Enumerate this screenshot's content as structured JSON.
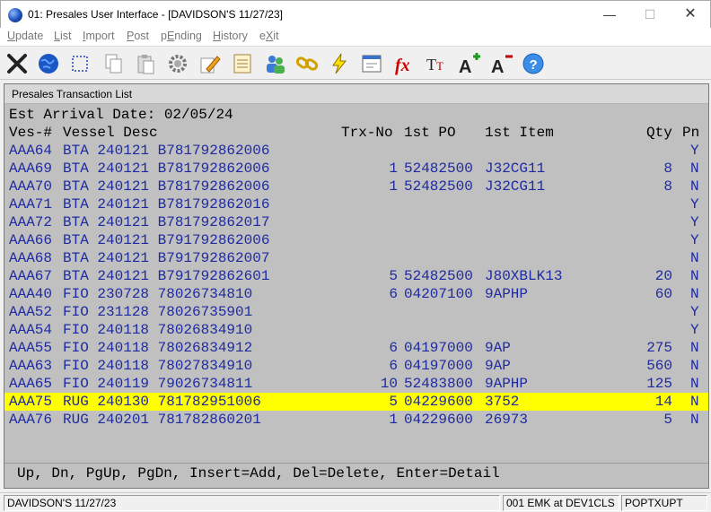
{
  "window": {
    "title": "01: Presales User Interface - [DAVIDSON'S 11/27/23]"
  },
  "menu": [
    {
      "label": "Update",
      "active": true
    },
    {
      "label": "List",
      "active": false
    },
    {
      "label": "Import",
      "active": false
    },
    {
      "label": "Post",
      "active": false
    },
    {
      "label": "pEnding",
      "active": false
    },
    {
      "label": "History",
      "active": false
    },
    {
      "label": "eXit",
      "active": false
    }
  ],
  "toolbar": [
    {
      "icon": "close-x-icon"
    },
    {
      "icon": "globe-icon"
    },
    {
      "icon": "select-box-icon"
    },
    {
      "icon": "copy-icon"
    },
    {
      "icon": "paste-icon"
    },
    {
      "icon": "settings-gear-icon"
    },
    {
      "icon": "edit-pencil-icon"
    },
    {
      "icon": "notepad-icon"
    },
    {
      "icon": "users-icon"
    },
    {
      "icon": "chain-link-icon"
    },
    {
      "icon": "lightning-icon"
    },
    {
      "icon": "form-icon"
    },
    {
      "icon": "function-fx-icon"
    },
    {
      "icon": "text-size-icon"
    },
    {
      "icon": "font-increase-icon"
    },
    {
      "icon": "font-decrease-icon"
    },
    {
      "icon": "help-icon"
    }
  ],
  "panel": {
    "title": "Presales Transaction List",
    "arrival_label": "Est Arrival Date: 02/05/24",
    "columns": {
      "ves": "Ves-#",
      "desc": "Vessel Desc",
      "trx": "Trx-No",
      "po": "1st PO",
      "item": "1st Item",
      "qty": "Qty",
      "pn": "Pn"
    },
    "rows": [
      {
        "ves": "AAA64",
        "desc": "BTA 240121 B781792862006",
        "trx": "",
        "po": "",
        "item": "",
        "qty": "",
        "pn": "Y"
      },
      {
        "ves": "AAA69",
        "desc": "BTA 240121 B781792862006",
        "trx": "1",
        "po": "52482500",
        "item": "J32CG11",
        "qty": "8",
        "pn": "N"
      },
      {
        "ves": "AAA70",
        "desc": "BTA 240121 B781792862006",
        "trx": "1",
        "po": "52482500",
        "item": "J32CG11",
        "qty": "8",
        "pn": "N"
      },
      {
        "ves": "AAA71",
        "desc": "BTA 240121 B781792862016",
        "trx": "",
        "po": "",
        "item": "",
        "qty": "",
        "pn": "Y"
      },
      {
        "ves": "AAA72",
        "desc": "BTA 240121 B781792862017",
        "trx": "",
        "po": "",
        "item": "",
        "qty": "",
        "pn": "Y"
      },
      {
        "ves": "AAA66",
        "desc": "BTA 240121 B791792862006",
        "trx": "",
        "po": "",
        "item": "",
        "qty": "",
        "pn": "Y"
      },
      {
        "ves": "AAA68",
        "desc": "BTA 240121 B791792862007",
        "trx": "",
        "po": "",
        "item": "",
        "qty": "",
        "pn": "N"
      },
      {
        "ves": "AAA67",
        "desc": "BTA 240121 B791792862601",
        "trx": "5",
        "po": "52482500",
        "item": "J80XBLK13",
        "qty": "20",
        "pn": "N"
      },
      {
        "ves": "AAA40",
        "desc": "FIO 230728 78026734810",
        "trx": "6",
        "po": "04207100",
        "item": "9APHP",
        "qty": "60",
        "pn": "N"
      },
      {
        "ves": "AAA52",
        "desc": "FIO 231128 78026735901",
        "trx": "",
        "po": "",
        "item": "",
        "qty": "",
        "pn": "Y"
      },
      {
        "ves": "AAA54",
        "desc": "FIO 240118 78026834910",
        "trx": "",
        "po": "",
        "item": "",
        "qty": "",
        "pn": "Y"
      },
      {
        "ves": "AAA55",
        "desc": "FIO 240118 78026834912",
        "trx": "6",
        "po": "04197000",
        "item": "9AP",
        "qty": "275",
        "pn": "N"
      },
      {
        "ves": "AAA63",
        "desc": "FIO 240118 78027834910",
        "trx": "6",
        "po": "04197000",
        "item": "9AP",
        "qty": "560",
        "pn": "N"
      },
      {
        "ves": "AAA65",
        "desc": "FIO 240119 79026734811",
        "trx": "10",
        "po": "52483800",
        "item": "9APHP",
        "qty": "125",
        "pn": "N"
      },
      {
        "ves": "AAA75",
        "desc": "RUG 240130 781782951006",
        "trx": "5",
        "po": "04229600",
        "item": "3752",
        "qty": "14",
        "pn": "N",
        "selected": true
      },
      {
        "ves": "AAA76",
        "desc": "RUG 240201 781782860201",
        "trx": "1",
        "po": "04229600",
        "item": "26973",
        "qty": "5",
        "pn": "N"
      }
    ],
    "footer_help": "Up, Dn, PgUp, PgDn, Insert=Add, Del=Delete, Enter=Detail"
  },
  "status": {
    "company": "DAVIDSON'S 11/27/23",
    "session": "001 EMK at DEV1CLS",
    "program": "POPTXUPT"
  }
}
